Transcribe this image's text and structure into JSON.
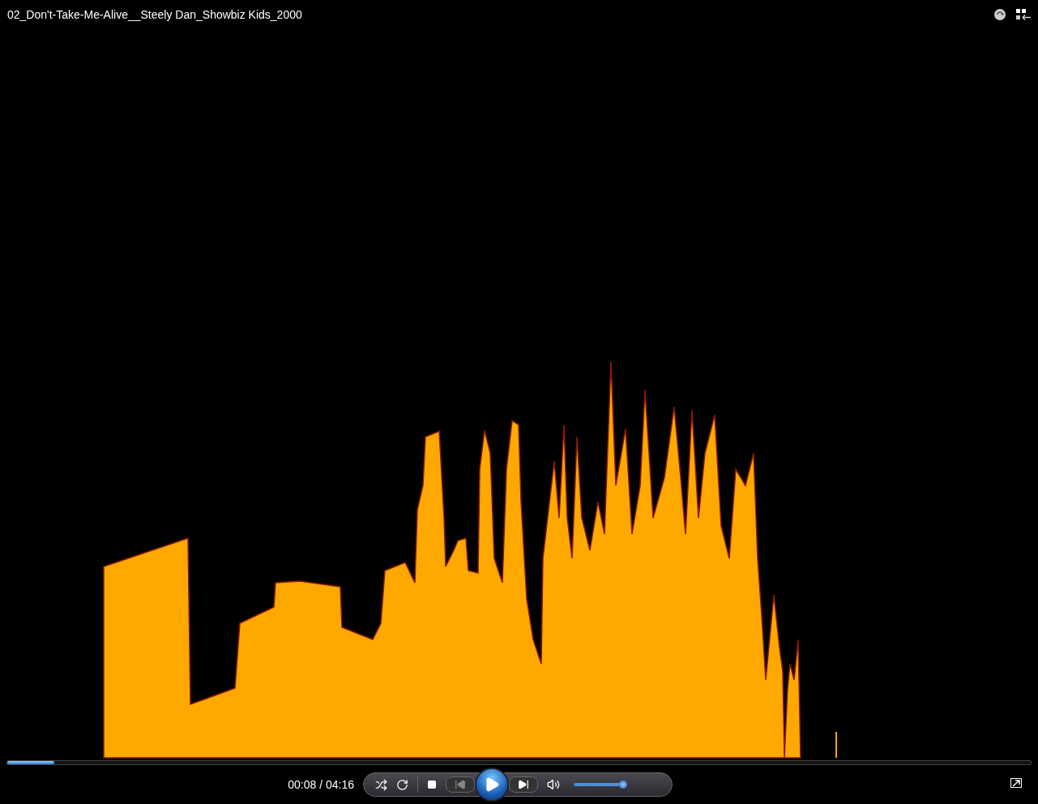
{
  "window": {
    "title": "02_Don't-Take-Me-Alive__Steely Dan_Showbiz Kids_2000"
  },
  "seek": {
    "level": 0.046
  },
  "player": {
    "time": "00:08 / 04:16",
    "volume": {
      "level": 0.93
    }
  }
}
